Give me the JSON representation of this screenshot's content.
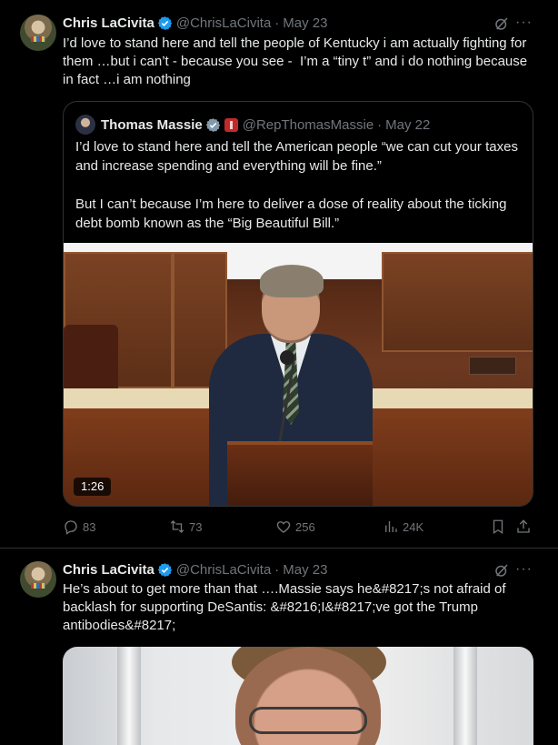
{
  "posts": [
    {
      "author_name": "Chris LaCivita",
      "handle": "@ChrisLaCivita",
      "separator": "·",
      "date": "May 23",
      "text": "I’d love to stand here and tell the people of Kentucky i am actually fighting for them …but i can’t - because you see -  I’m a “tiny t” and i do nothing because in fact …i am nothing",
      "quote": {
        "author_name": "Thomas Massie",
        "handle": "@RepThomasMassie",
        "separator": "·",
        "date": "May 22",
        "text_p1": "I’d love to stand here and tell the American people “we can cut your taxes and increase spending and everything will be fine.”",
        "text_p2": "But I can’t because I’m here to deliver a dose of reality about the ticking debt bomb known as the “Big Beautiful Bill.”",
        "video_duration": "1:26"
      },
      "stats": {
        "replies": "83",
        "reposts": "73",
        "likes": "256",
        "views": "24K"
      }
    },
    {
      "author_name": "Chris LaCivita",
      "handle": "@ChrisLaCivita",
      "separator": "·",
      "date": "May 23",
      "text": "He’s about to get more than that ….Massie says he&#8217;s not afraid of backlash for supporting DeSantis: &#8216;I&#8217;ve got the Trump antibodies&#8217;"
    }
  ],
  "icons": {
    "verified": "verified-badge-icon",
    "grok": "grok-icon",
    "more": "more-icon",
    "reply": "reply-icon",
    "repost": "repost-icon",
    "like": "like-icon",
    "views": "views-icon",
    "bookmark": "bookmark-icon",
    "share": "share-icon"
  },
  "colors": {
    "background": "#000000",
    "text": "#e7e9ea",
    "muted": "#71767b",
    "border": "#2f3336",
    "verified": "#1d9bf0"
  }
}
